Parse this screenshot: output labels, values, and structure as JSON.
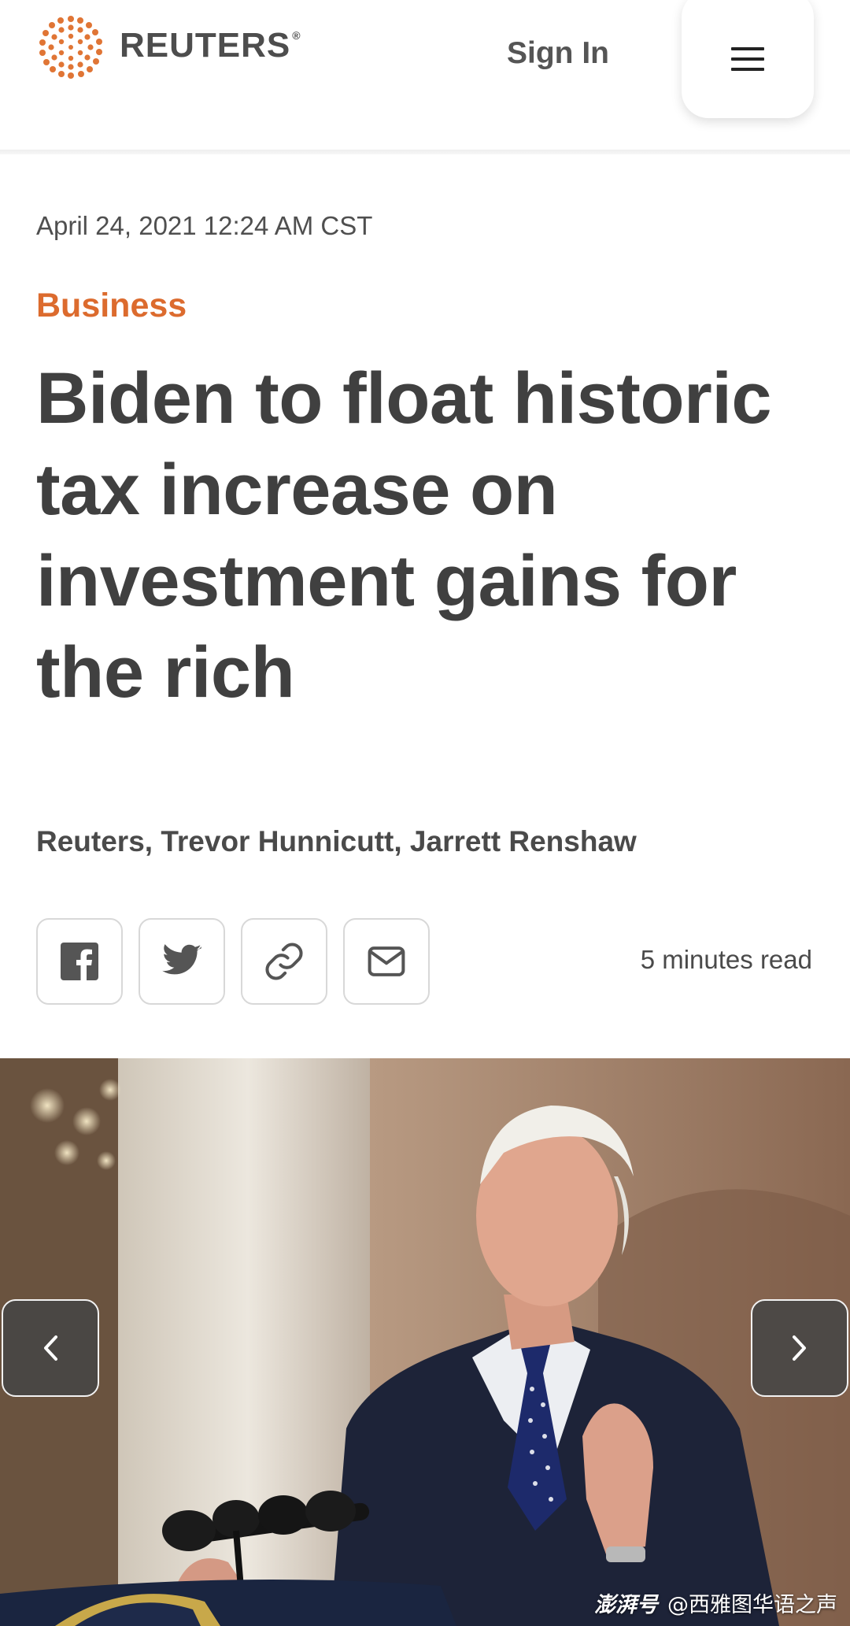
{
  "header": {
    "brand": "REUTERS",
    "brand_mark": "®",
    "sign_in_label": "Sign In",
    "menu_icon": "hamburger-menu-icon",
    "brand_color": "#dc6b2e"
  },
  "article": {
    "dateline": "April 24, 2021 12:24 AM CST",
    "category": "Business",
    "headline_lines": [
      "Biden to float historic",
      "tax increase on",
      "investment gains for",
      "the rich"
    ],
    "byline": "Reuters, Trevor Hunnicutt, Jarrett Renshaw",
    "read_time": "5 minutes read"
  },
  "share": {
    "buttons": [
      {
        "name": "facebook",
        "icon": "facebook-icon"
      },
      {
        "name": "twitter",
        "icon": "twitter-icon"
      },
      {
        "name": "copy-link",
        "icon": "link-icon"
      },
      {
        "name": "email",
        "icon": "mail-icon"
      }
    ]
  },
  "hero": {
    "prev_icon": "chevron-left-icon",
    "next_icon": "chevron-right-icon",
    "watermark_brand": "澎湃号",
    "watermark_account": "@西雅图华语之声"
  }
}
